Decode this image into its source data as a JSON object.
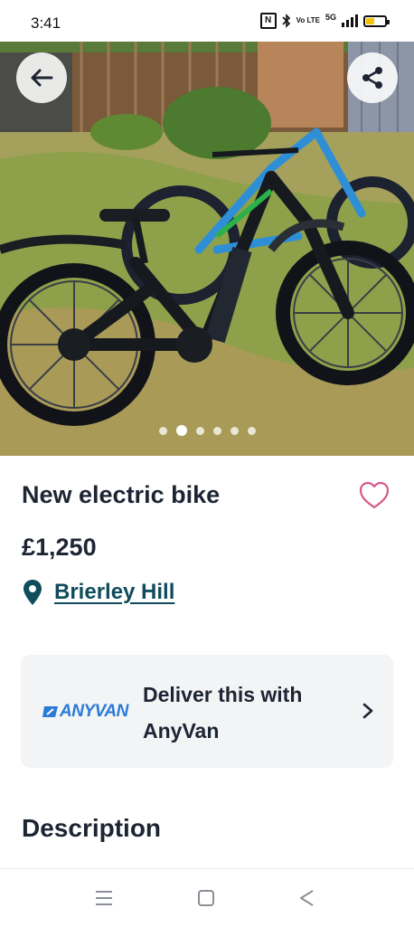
{
  "status_bar": {
    "time": "3:41",
    "network": "5G",
    "volte": "Vo LTE",
    "battery_level": 0.35,
    "battery_color": "#f5c400"
  },
  "gallery": {
    "image_count": 6,
    "active_index": 1,
    "back_icon": "arrow-left-icon",
    "share_icon": "share-icon"
  },
  "listing": {
    "title": "New electric bike",
    "price": "£1,250",
    "location": "Brierley Hill",
    "favorite_icon": "heart-outline-icon",
    "location_icon": "map-pin-icon"
  },
  "delivery": {
    "logo_text": "ANYVAN",
    "text": "Deliver this with AnyVan",
    "chevron_icon": "chevron-right-icon"
  },
  "description": {
    "heading": "Description"
  },
  "colors": {
    "text_primary": "#1d2433",
    "link": "#0f4c5c",
    "heart": "#d45a8c",
    "anyvan_blue": "#2a7bd6",
    "card_bg": "#f3f4f6"
  },
  "system_nav": [
    "menu-icon",
    "home-icon",
    "back-triangle-icon"
  ]
}
